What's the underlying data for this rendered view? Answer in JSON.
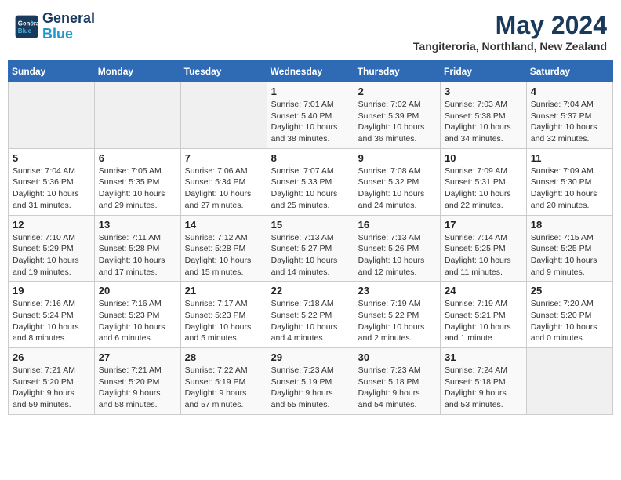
{
  "header": {
    "logo_line1": "General",
    "logo_line2": "Blue",
    "month_year": "May 2024",
    "location": "Tangiteroria, Northland, New Zealand"
  },
  "weekdays": [
    "Sunday",
    "Monday",
    "Tuesday",
    "Wednesday",
    "Thursday",
    "Friday",
    "Saturday"
  ],
  "weeks": [
    [
      {
        "day": "",
        "info": ""
      },
      {
        "day": "",
        "info": ""
      },
      {
        "day": "",
        "info": ""
      },
      {
        "day": "1",
        "info": "Sunrise: 7:01 AM\nSunset: 5:40 PM\nDaylight: 10 hours\nand 38 minutes."
      },
      {
        "day": "2",
        "info": "Sunrise: 7:02 AM\nSunset: 5:39 PM\nDaylight: 10 hours\nand 36 minutes."
      },
      {
        "day": "3",
        "info": "Sunrise: 7:03 AM\nSunset: 5:38 PM\nDaylight: 10 hours\nand 34 minutes."
      },
      {
        "day": "4",
        "info": "Sunrise: 7:04 AM\nSunset: 5:37 PM\nDaylight: 10 hours\nand 32 minutes."
      }
    ],
    [
      {
        "day": "5",
        "info": "Sunrise: 7:04 AM\nSunset: 5:36 PM\nDaylight: 10 hours\nand 31 minutes."
      },
      {
        "day": "6",
        "info": "Sunrise: 7:05 AM\nSunset: 5:35 PM\nDaylight: 10 hours\nand 29 minutes."
      },
      {
        "day": "7",
        "info": "Sunrise: 7:06 AM\nSunset: 5:34 PM\nDaylight: 10 hours\nand 27 minutes."
      },
      {
        "day": "8",
        "info": "Sunrise: 7:07 AM\nSunset: 5:33 PM\nDaylight: 10 hours\nand 25 minutes."
      },
      {
        "day": "9",
        "info": "Sunrise: 7:08 AM\nSunset: 5:32 PM\nDaylight: 10 hours\nand 24 minutes."
      },
      {
        "day": "10",
        "info": "Sunrise: 7:09 AM\nSunset: 5:31 PM\nDaylight: 10 hours\nand 22 minutes."
      },
      {
        "day": "11",
        "info": "Sunrise: 7:09 AM\nSunset: 5:30 PM\nDaylight: 10 hours\nand 20 minutes."
      }
    ],
    [
      {
        "day": "12",
        "info": "Sunrise: 7:10 AM\nSunset: 5:29 PM\nDaylight: 10 hours\nand 19 minutes."
      },
      {
        "day": "13",
        "info": "Sunrise: 7:11 AM\nSunset: 5:28 PM\nDaylight: 10 hours\nand 17 minutes."
      },
      {
        "day": "14",
        "info": "Sunrise: 7:12 AM\nSunset: 5:28 PM\nDaylight: 10 hours\nand 15 minutes."
      },
      {
        "day": "15",
        "info": "Sunrise: 7:13 AM\nSunset: 5:27 PM\nDaylight: 10 hours\nand 14 minutes."
      },
      {
        "day": "16",
        "info": "Sunrise: 7:13 AM\nSunset: 5:26 PM\nDaylight: 10 hours\nand 12 minutes."
      },
      {
        "day": "17",
        "info": "Sunrise: 7:14 AM\nSunset: 5:25 PM\nDaylight: 10 hours\nand 11 minutes."
      },
      {
        "day": "18",
        "info": "Sunrise: 7:15 AM\nSunset: 5:25 PM\nDaylight: 10 hours\nand 9 minutes."
      }
    ],
    [
      {
        "day": "19",
        "info": "Sunrise: 7:16 AM\nSunset: 5:24 PM\nDaylight: 10 hours\nand 8 minutes."
      },
      {
        "day": "20",
        "info": "Sunrise: 7:16 AM\nSunset: 5:23 PM\nDaylight: 10 hours\nand 6 minutes."
      },
      {
        "day": "21",
        "info": "Sunrise: 7:17 AM\nSunset: 5:23 PM\nDaylight: 10 hours\nand 5 minutes."
      },
      {
        "day": "22",
        "info": "Sunrise: 7:18 AM\nSunset: 5:22 PM\nDaylight: 10 hours\nand 4 minutes."
      },
      {
        "day": "23",
        "info": "Sunrise: 7:19 AM\nSunset: 5:22 PM\nDaylight: 10 hours\nand 2 minutes."
      },
      {
        "day": "24",
        "info": "Sunrise: 7:19 AM\nSunset: 5:21 PM\nDaylight: 10 hours\nand 1 minute."
      },
      {
        "day": "25",
        "info": "Sunrise: 7:20 AM\nSunset: 5:20 PM\nDaylight: 10 hours\nand 0 minutes."
      }
    ],
    [
      {
        "day": "26",
        "info": "Sunrise: 7:21 AM\nSunset: 5:20 PM\nDaylight: 9 hours\nand 59 minutes."
      },
      {
        "day": "27",
        "info": "Sunrise: 7:21 AM\nSunset: 5:20 PM\nDaylight: 9 hours\nand 58 minutes."
      },
      {
        "day": "28",
        "info": "Sunrise: 7:22 AM\nSunset: 5:19 PM\nDaylight: 9 hours\nand 57 minutes."
      },
      {
        "day": "29",
        "info": "Sunrise: 7:23 AM\nSunset: 5:19 PM\nDaylight: 9 hours\nand 55 minutes."
      },
      {
        "day": "30",
        "info": "Sunrise: 7:23 AM\nSunset: 5:18 PM\nDaylight: 9 hours\nand 54 minutes."
      },
      {
        "day": "31",
        "info": "Sunrise: 7:24 AM\nSunset: 5:18 PM\nDaylight: 9 hours\nand 53 minutes."
      },
      {
        "day": "",
        "info": ""
      }
    ]
  ]
}
